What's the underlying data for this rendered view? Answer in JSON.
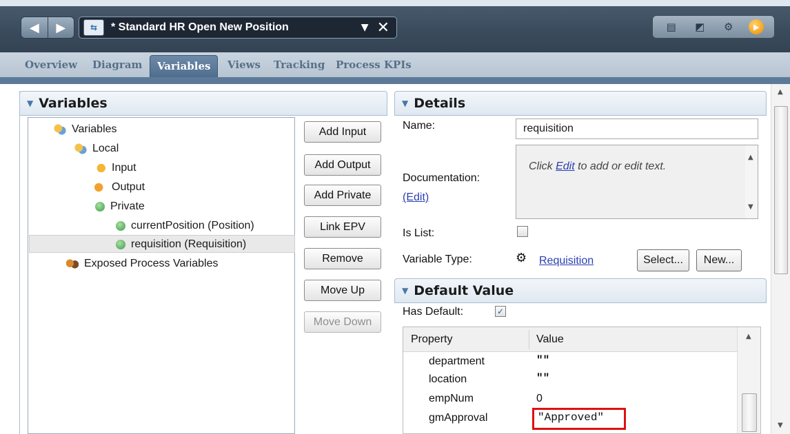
{
  "window": {
    "process_title": "* Standard HR Open New Position",
    "dropdown_glyph": "▼",
    "close_glyph": "✕"
  },
  "tabs": [
    "Overview",
    "Diagram",
    "Variables",
    "Views",
    "Tracking",
    "Process KPIs"
  ],
  "active_tab": "Variables",
  "variables_panel": {
    "title": "Variables",
    "tree": [
      {
        "label": "Variables",
        "icon": "variables-icon"
      },
      {
        "label": "Local",
        "icon": "local-icon"
      },
      {
        "label": "Input",
        "icon": "input-icon"
      },
      {
        "label": "Output",
        "icon": "output-icon"
      },
      {
        "label": "Private",
        "icon": "private-icon"
      },
      {
        "label": "currentPosition (Position)",
        "icon": "private-variable-icon"
      },
      {
        "label": "requisition (Requisition)",
        "icon": "private-variable-icon",
        "selected": true
      },
      {
        "label": "Exposed Process Variables",
        "icon": "exposed-process-variables-icon"
      }
    ],
    "buttons": {
      "add_input": "Add Input",
      "add_output": "Add Output",
      "add_private": "Add Private",
      "link_epv": "Link EPV",
      "remove": "Remove",
      "move_up": "Move Up",
      "move_down": "Move Down"
    }
  },
  "details_panel": {
    "title": "Details",
    "name_label": "Name:",
    "name_value": "requisition",
    "documentation_label": "Documentation:",
    "documentation_edit_link": "(Edit)",
    "documentation_text_before": "Click ",
    "documentation_text_link": "Edit",
    "documentation_text_after": " to add or edit text.",
    "is_list_label": "Is List:",
    "is_list_checked": false,
    "variable_type_label": "Variable Type:",
    "variable_type_value": "Requisition",
    "select_button": "Select...",
    "new_button": "New..."
  },
  "default_value_panel": {
    "title": "Default Value",
    "has_default_label": "Has Default:",
    "has_default_checked": true,
    "check_glyph": "✓",
    "columns": [
      "Property",
      "Value"
    ],
    "rows": [
      {
        "property": "department",
        "value": "\"\""
      },
      {
        "property": "location",
        "value": "\"\""
      },
      {
        "property": "empNum",
        "value": "0"
      },
      {
        "property": "gmApproval",
        "value": "\"Approved\""
      }
    ]
  },
  "colors": {
    "accent_tab": "#4e6d8e",
    "highlight_border": "#e01010",
    "link": "#2a3fb0"
  }
}
